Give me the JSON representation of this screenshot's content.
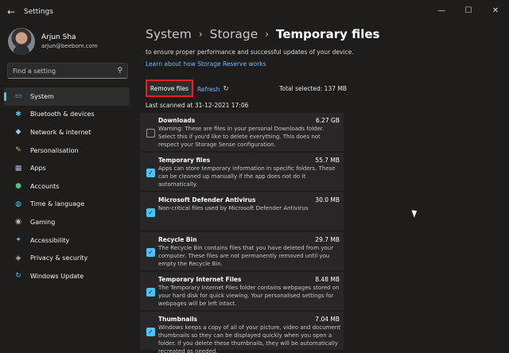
{
  "window": {
    "back_icon": "back-arrow-icon",
    "title": "Settings",
    "controls": {
      "minimize": "—",
      "maximize": "☐",
      "close": "✕"
    }
  },
  "profile": {
    "name": "Arjun Sha",
    "email": "arjun@beebom.com"
  },
  "search": {
    "placeholder": "Find a setting"
  },
  "nav": {
    "accent": "#4cc2ff",
    "items": [
      {
        "label": "System",
        "icon": "system-icon",
        "glyph": "▭",
        "color": "#4cc2ff"
      },
      {
        "label": "Bluetooth & devices",
        "icon": "bluetooth-icon",
        "glyph": "✱",
        "color": "#4cc2ff"
      },
      {
        "label": "Network & internet",
        "icon": "network-icon",
        "glyph": "◆",
        "color": "#9ec7e8"
      },
      {
        "label": "Personalisation",
        "icon": "brush-icon",
        "glyph": "✎",
        "color": "#e8a65a"
      },
      {
        "label": "Apps",
        "icon": "apps-icon",
        "glyph": "▦",
        "color": "#a6b9d8"
      },
      {
        "label": "Accounts",
        "icon": "accounts-icon",
        "glyph": "●",
        "color": "#4cc27a"
      },
      {
        "label": "Time & language",
        "icon": "globe-icon",
        "glyph": "◍",
        "color": "#4cc2ff"
      },
      {
        "label": "Gaming",
        "icon": "gaming-icon",
        "glyph": "◉",
        "color": "#bcbcbc"
      },
      {
        "label": "Accessibility",
        "icon": "accessibility-icon",
        "glyph": "✦",
        "color": "#4cc2ff"
      },
      {
        "label": "Privacy & security",
        "icon": "shield-icon",
        "glyph": "◈",
        "color": "#bcbcbc"
      },
      {
        "label": "Windows Update",
        "icon": "update-icon",
        "glyph": "↻",
        "color": "#4cc2ff"
      }
    ]
  },
  "breadcrumb": {
    "system": "System",
    "storage": "Storage",
    "current": "Temporary files",
    "separator": "›"
  },
  "main": {
    "description": "to ensure proper performance and successful updates of your device.",
    "learn_link": "Learn about how Storage Reserve works",
    "remove_label": "Remove files",
    "refresh_label": "Refresh",
    "total_selected": "Total selected: 137 MB",
    "last_scanned": "Last scanned at 31-12-2021 17:06"
  },
  "files": [
    {
      "name": "Downloads",
      "size": "6.27 GB",
      "checked": false,
      "desc": "Warning: These are files in your personal Downloads folder. Select this if you'd like to delete everything. This does not respect your Storage Sense configuration."
    },
    {
      "name": "Temporary files",
      "size": "55.7 MB",
      "checked": true,
      "desc": "Apps can store temporary information in specific folders. These can be cleaned up manually if the app does not do it automatically."
    },
    {
      "name": "Microsoft Defender Antivirus",
      "size": "30.0 MB",
      "checked": true,
      "desc": "Non-critical files used by Microsoft Defender Antivirus"
    },
    {
      "name": "Recycle Bin",
      "size": "29.7 MB",
      "checked": true,
      "desc": "The Recycle Bin contains files that you have deleted from your computer. These files are not permanently removed until you empty the Recycle Bin."
    },
    {
      "name": "Temporary Internet Files",
      "size": "8.48 MB",
      "checked": true,
      "desc": "The Temporary Internet Files folder contains webpages stored on your hard disk for quick viewing. Your personalised settings for webpages will be left intact."
    },
    {
      "name": "Thumbnails",
      "size": "7.04 MB",
      "checked": true,
      "desc": "Windows keeps a copy of all of your picture, video and document thumbnails so they can be displayed quickly when you open a folder. If you delete these thumbnails, they will be automatically recreated as needed."
    }
  ]
}
